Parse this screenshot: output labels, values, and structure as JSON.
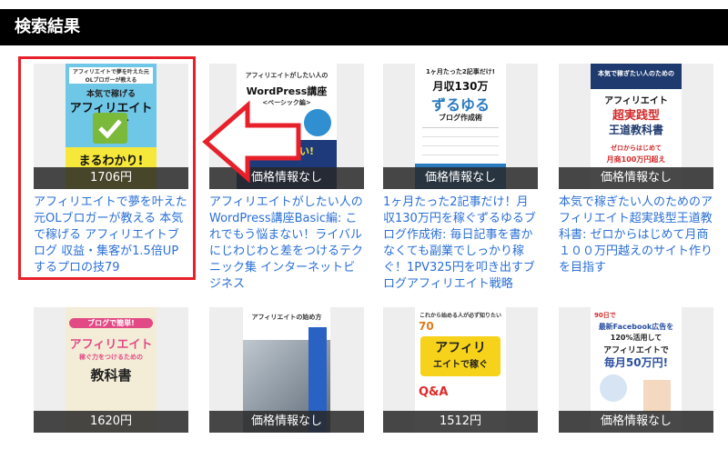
{
  "header": {
    "title": "検索結果"
  },
  "books": [
    {
      "cover_lines": [
        "アフィリエイトで夢を叶えた元OLブロガーが教える",
        "本気で稼げる",
        "アフィリエイトブログ",
        "まるわかり!"
      ],
      "price": "1706円",
      "title": "アフィリエイトで夢を叶えた元OLブロガーが教える 本気で稼げる アフィリエイトブログ 収益・集客が1.5倍UPするプロの技79"
    },
    {
      "cover_lines": [
        "アフィリエイトがしたい人の",
        "WordPress講座",
        "<ベーシック編>",
        "で悩まない!"
      ],
      "price": "価格情報なし",
      "title": "アフィリエイトがしたい人のWordPress講座Basic編: これでもう悩まない！ライバルにじわじわと差をつけるテクニック集 インターネットビジネス"
    },
    {
      "cover_lines": [
        "1ヶ月たった2記事だけ!",
        "月収130万",
        "ずるゆる",
        "ブログ作成術"
      ],
      "price": "価格情報なし",
      "title": "1ヶ月たった2記事だけ！月収130万円を稼ぐずるゆるブログ作成術: 毎日記事を書かなくても副業でしっかり稼ぐ！1PV325円を叩き出すブログアフィリエイト戦略"
    },
    {
      "cover_lines": [
        "本気で稼ぎたい人のための",
        "アフィリエイト",
        "超実践型",
        "王道教科書",
        "ゼロからはじめて",
        "月商100万円超え"
      ],
      "price": "価格情報なし",
      "title": "本気で稼ぎたい人のためのアフィリエイト超実践型王道教科書: ゼロからはじめて月商１００万円越えのサイト作りを目指す"
    },
    {
      "cover_lines": [
        "ブログで簡単!",
        "アフィリエイト",
        "稼ぐ力をつけるための",
        "教科書"
      ],
      "price": "1620円",
      "title": ""
    },
    {
      "cover_lines": [
        "アフィリエイトの始め方"
      ],
      "price": "価格情報なし",
      "title": ""
    },
    {
      "cover_lines": [
        "これから始める人が必ず知りたい",
        "70",
        "アフィリ",
        "エイトで稼ぐ",
        "Q&A"
      ],
      "price": "1512円",
      "title": ""
    },
    {
      "cover_lines": [
        "90日で",
        "最新Facebook広告を",
        "120%活用して",
        "アフィリエイトで",
        "毎月50万円!"
      ],
      "price": "価格情報なし",
      "title": ""
    }
  ],
  "colors": {
    "link": "#2a6fd6",
    "highlight": "#e8202a",
    "header_bg": "#000000"
  },
  "icons": {
    "check": "check-icon",
    "arrow": "arrow-left-icon"
  }
}
